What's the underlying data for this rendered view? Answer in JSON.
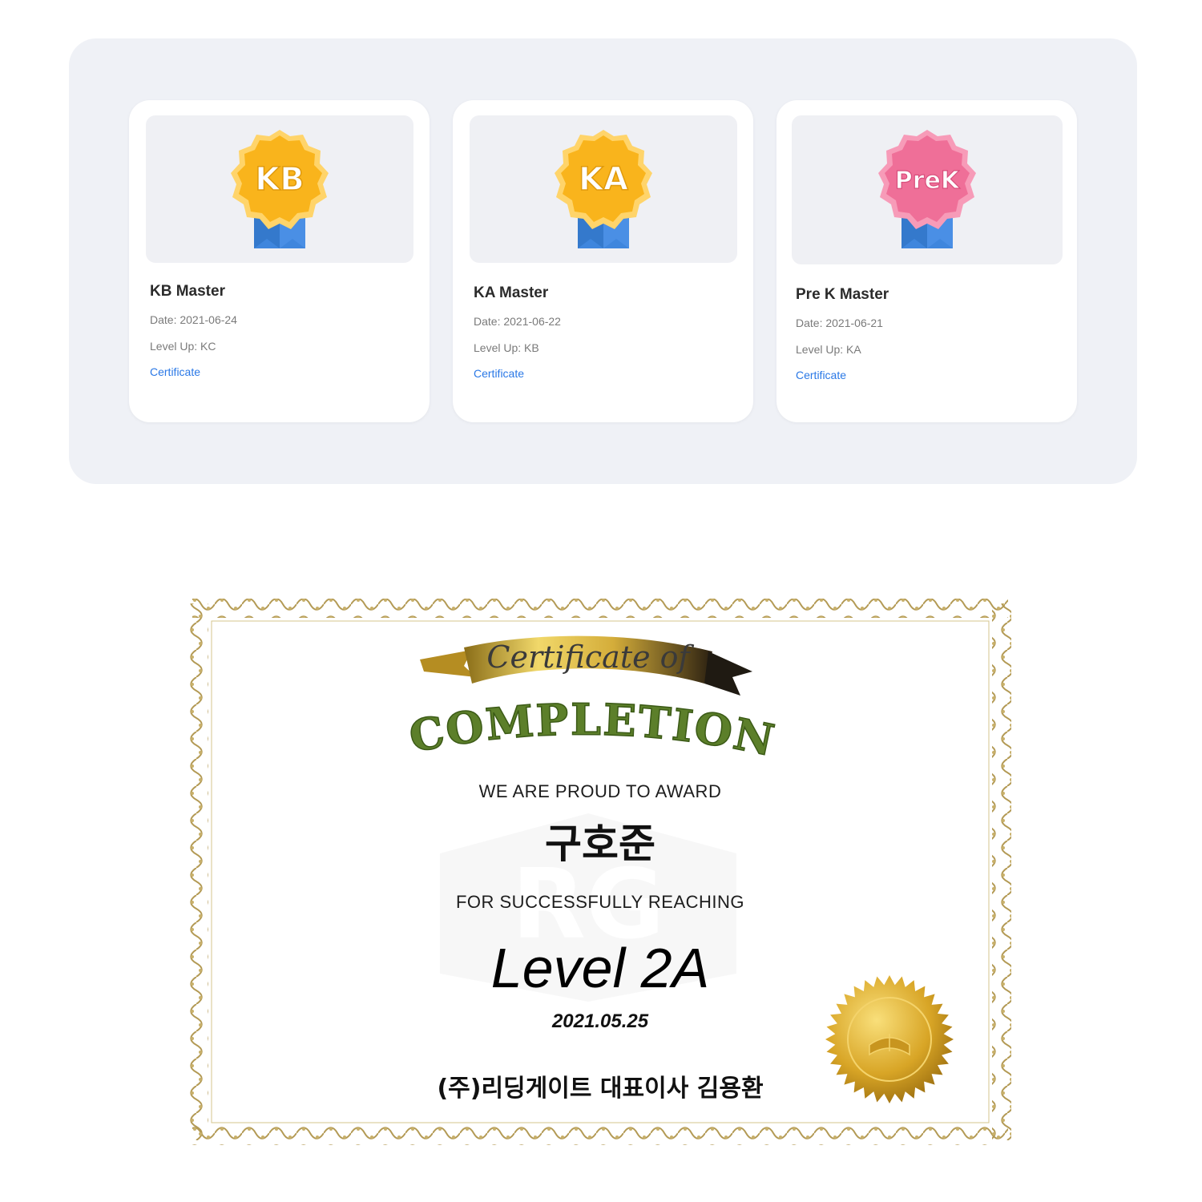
{
  "cards": [
    {
      "badge_text": "KB",
      "badge_color": "#f9b41c",
      "title": "KB Master",
      "date": "Date: 2021-06-24",
      "level_up": "Level Up: KC",
      "link_label": "Certificate"
    },
    {
      "badge_text": "KA",
      "badge_color": "#f9b41c",
      "title": "KA Master",
      "date": "Date: 2021-06-22",
      "level_up": "Level Up: KB",
      "link_label": "Certificate"
    },
    {
      "badge_text": "PreK",
      "badge_color": "#ef6f98",
      "title": "Pre K Master",
      "date": "Date: 2021-06-21",
      "level_up": "Level Up: KA",
      "link_label": "Certificate"
    }
  ],
  "certificate": {
    "ribbon_text": "Certificate of",
    "heading": "COMPLETION",
    "award_line": "WE ARE PROUD TO AWARD",
    "recipient": "구호준",
    "reach_line": "FOR SUCCESSFULLY REACHING",
    "level": "Level 2A",
    "date": "2021.05.25",
    "signer": "(주)리딩게이트 대표이사 김용환",
    "watermark_text": "RG",
    "border_color": "#b39a55",
    "heading_color": "#5c7f2a",
    "seal_color": "#d8a526"
  }
}
